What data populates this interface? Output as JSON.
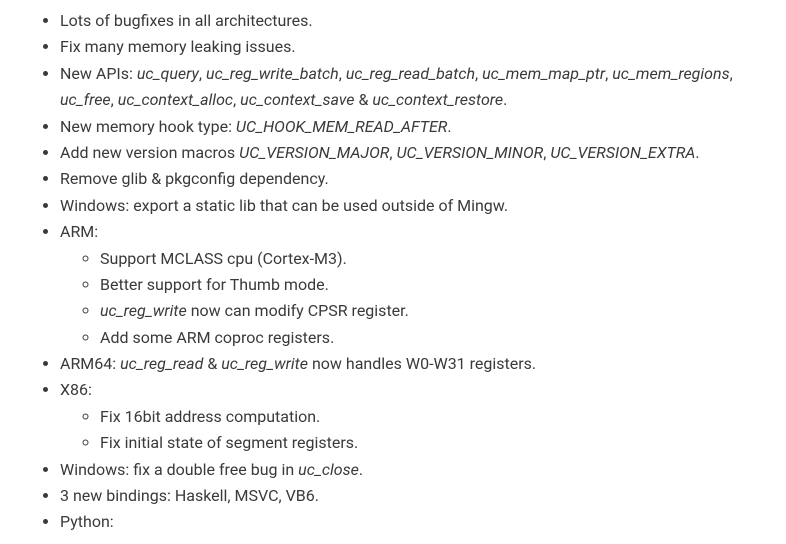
{
  "items": [
    {
      "type": "text",
      "text": "Lots of bugfixes in all architectures."
    },
    {
      "type": "text",
      "text": "Fix many memory leaking issues."
    },
    {
      "type": "apis",
      "prefix": "New APIs: ",
      "apis": [
        "uc_query",
        "uc_reg_write_batch",
        "uc_reg_read_batch",
        "uc_mem_map_ptr",
        "uc_mem_regions",
        "uc_free",
        "uc_context_alloc",
        "uc_context_save"
      ],
      "last_sep": " & ",
      "last": "uc_context_restore",
      "suffix": "."
    },
    {
      "type": "em1",
      "prefix": "New memory hook type: ",
      "em": "UC_HOOK_MEM_READ_AFTER",
      "suffix": "."
    },
    {
      "type": "macros",
      "prefix": "Add new version macros ",
      "m1": "UC_VERSION_MAJOR",
      "m2": "UC_VERSION_MINOR",
      "m3": "UC_VERSION_EXTRA",
      "suffix": "."
    },
    {
      "type": "text",
      "text": "Remove glib & pkgconfig dependency."
    },
    {
      "type": "text",
      "text": "Windows: export a static lib that can be used outside of Mingw."
    },
    {
      "type": "nested",
      "label": "ARM:",
      "children": [
        {
          "type": "text",
          "text": "Support MCLASS cpu (Cortex-M3)."
        },
        {
          "type": "text",
          "text": "Better support for Thumb mode."
        },
        {
          "type": "em1",
          "prefix": "",
          "em": "uc_reg_write",
          "suffix": " now can modify CPSR register."
        },
        {
          "type": "text",
          "text": "Add some ARM coproc registers."
        }
      ]
    },
    {
      "type": "arm64",
      "prefix": "ARM64: ",
      "e1": "uc_reg_read",
      "amp": " & ",
      "e2": "uc_reg_write",
      "suffix": " now handles W0-W31 registers."
    },
    {
      "type": "nested",
      "label": "X86:",
      "children": [
        {
          "type": "text",
          "text": "Fix 16bit address computation."
        },
        {
          "type": "text",
          "text": "Fix initial state of segment registers."
        }
      ]
    },
    {
      "type": "em1",
      "prefix": "Windows: fix a double free bug in ",
      "em": "uc_close",
      "suffix": "."
    },
    {
      "type": "text",
      "text": "3 new bindings: Haskell, MSVC, VB6."
    },
    {
      "type": "nested",
      "label": "Python:",
      "children": []
    }
  ]
}
